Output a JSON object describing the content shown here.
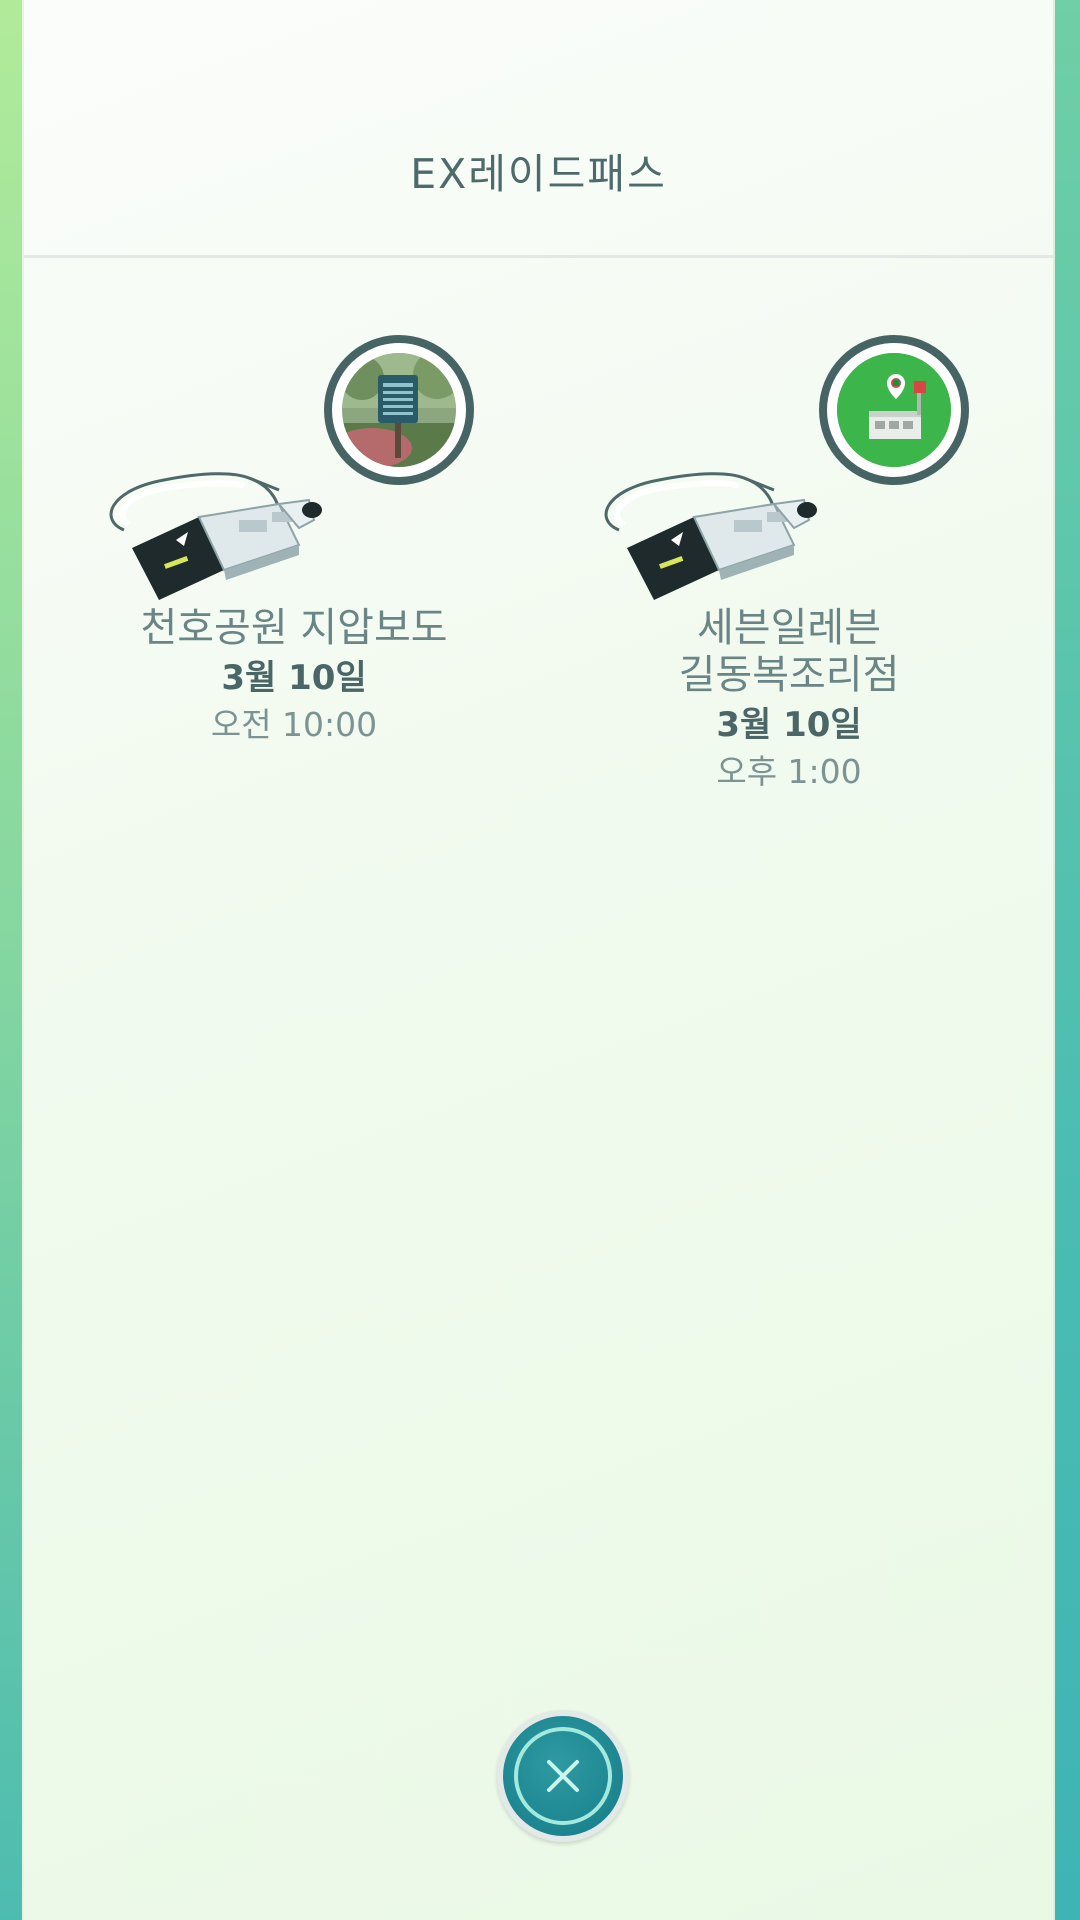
{
  "header": {
    "title": "EX레이드패스"
  },
  "passes": [
    {
      "gym_name_line1": "천호공원 지압보도",
      "gym_name_line2": "",
      "date": "3월 10일",
      "time": "오전 10:00"
    },
    {
      "gym_name_line1": "세븐일레븐",
      "gym_name_line2": "길동복조리점",
      "date": "3월 10일",
      "time": "오후 1:00"
    }
  ],
  "colors": {
    "accent": "#1c8590",
    "ring": "#476465",
    "gym_green": "#3cb54a"
  },
  "icons": {
    "close": "close-icon",
    "pass": "raid-pass-icon"
  }
}
